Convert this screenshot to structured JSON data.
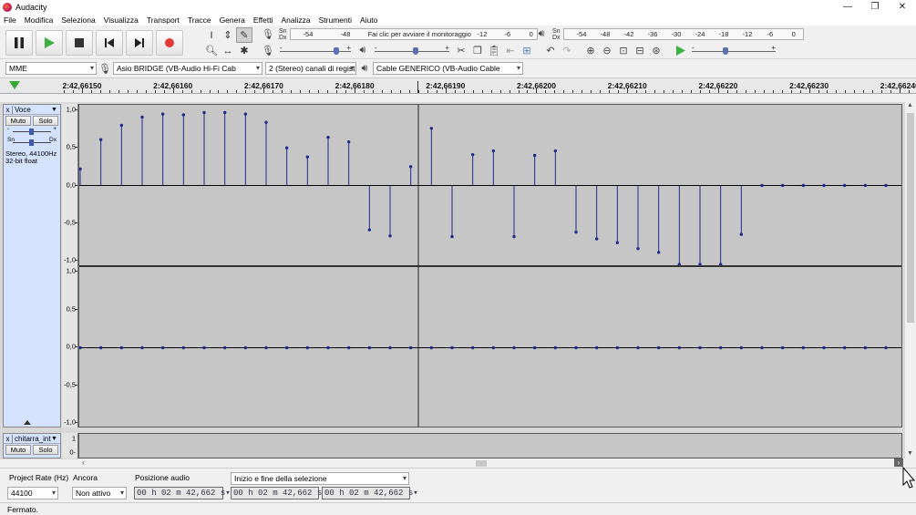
{
  "window": {
    "title": "Audacity",
    "minimize": "—",
    "maximize": "❐",
    "close": "✕"
  },
  "menu": [
    "File",
    "Modifica",
    "Seleziona",
    "Visualizza",
    "Transport",
    "Tracce",
    "Genera",
    "Effetti",
    "Analizza",
    "Strumenti",
    "Aiuto"
  ],
  "record_meter": {
    "lr": "Sn\nDx",
    "scale": [
      "-54",
      "-48",
      "Fai clic per avviare il monitoraggio",
      "-12",
      "-6",
      "0"
    ]
  },
  "play_meter": {
    "lr": "Sn\nDx",
    "scale": [
      "-54",
      "-48",
      "-42",
      "-36",
      "-30",
      "-24",
      "-18",
      "-12",
      "-6",
      "0"
    ]
  },
  "sliders": {
    "min": "-",
    "max": "+",
    "record_volume": 0.82,
    "play_volume": 0.55,
    "play_speed": 0.4
  },
  "devices": {
    "host": "MME",
    "input": "Asio BRIDGE (VB-Audio Hi-Fi Cab",
    "channels": "2 (Stereo) canali di registr",
    "output": "Cable GENERICO (VB-Audio Cable"
  },
  "timeline": {
    "labels": [
      "2:42,66150",
      "2:42,66160",
      "2:42,66170",
      "2:42,66180",
      "2:42,66190",
      "2:42,66200",
      "2:42,66210",
      "2:42,66220",
      "2:42,66230",
      "2:42,66240"
    ]
  },
  "track1": {
    "name": "Voce",
    "close": "x",
    "mute": "Muto",
    "solo": "Solo",
    "gain_min": "-",
    "gain_max": "+",
    "pan_left": "Sn",
    "pan_right": "Dx",
    "gain": 0.5,
    "pan": 0.5,
    "info_line1": "Stereo, 44100Hz",
    "info_line2": "32-bit float",
    "ruler": [
      "1,0",
      "0,5",
      "0,0",
      "-0,5",
      "-1,0"
    ],
    "channel_left_samples": [
      0.22,
      0.61,
      0.8,
      0.91,
      0.95,
      0.94,
      0.97,
      0.97,
      0.95,
      0.84,
      0.5,
      0.38,
      0.64,
      0.58,
      -0.59,
      -0.67,
      0.25,
      0.76,
      -0.68,
      0.41,
      0.46,
      -0.68,
      0.4,
      0.46,
      -0.62,
      -0.71,
      -0.76,
      -0.84,
      -0.89,
      -1.05,
      -1.05,
      -1.05,
      -0.65,
      0.0,
      0.0,
      0.0,
      0.0,
      0.0,
      0.0,
      0.0
    ],
    "channel_right_samples": [
      0.0,
      0.0,
      0.0,
      0.0,
      0.0,
      0.0,
      0.0,
      0.0,
      0.0,
      0.0,
      0.0,
      0.0,
      0.0,
      0.0,
      0.0,
      0.0,
      0.0,
      0.0,
      0.0,
      0.0,
      0.0,
      0.0,
      0.0,
      0.0,
      0.0,
      0.0,
      0.0,
      0.0,
      0.0,
      0.0,
      0.0,
      0.0,
      0.0,
      0.0,
      0.0,
      0.0,
      0.0,
      0.0,
      0.0,
      0.0
    ]
  },
  "track2": {
    "name": "chitarra_inte",
    "close": "x",
    "mute": "Muto",
    "solo": "Solo",
    "ruler": [
      "1",
      "0-"
    ]
  },
  "selection_toolbar": {
    "rate_label": "Project Rate (Hz)",
    "rate_value": "44100",
    "snap_label": "Ancora",
    "snap_value": "Non attivo",
    "pos_label": "Posizione audio",
    "pos_value": "00 h 02 m 42,662 s",
    "sel_mode": "Inizio e fine della selezione",
    "sel_start": "00 h 02 m 42,662 s",
    "sel_end": "00 h 02 m 42,662 s"
  },
  "status": "Fermato.",
  "colors": {
    "sample": "#1f2a8a",
    "wave_bg": "#c6c6c6",
    "track_panel": "#d4e2ff",
    "record": "#e53935",
    "play": "#3cb043"
  }
}
